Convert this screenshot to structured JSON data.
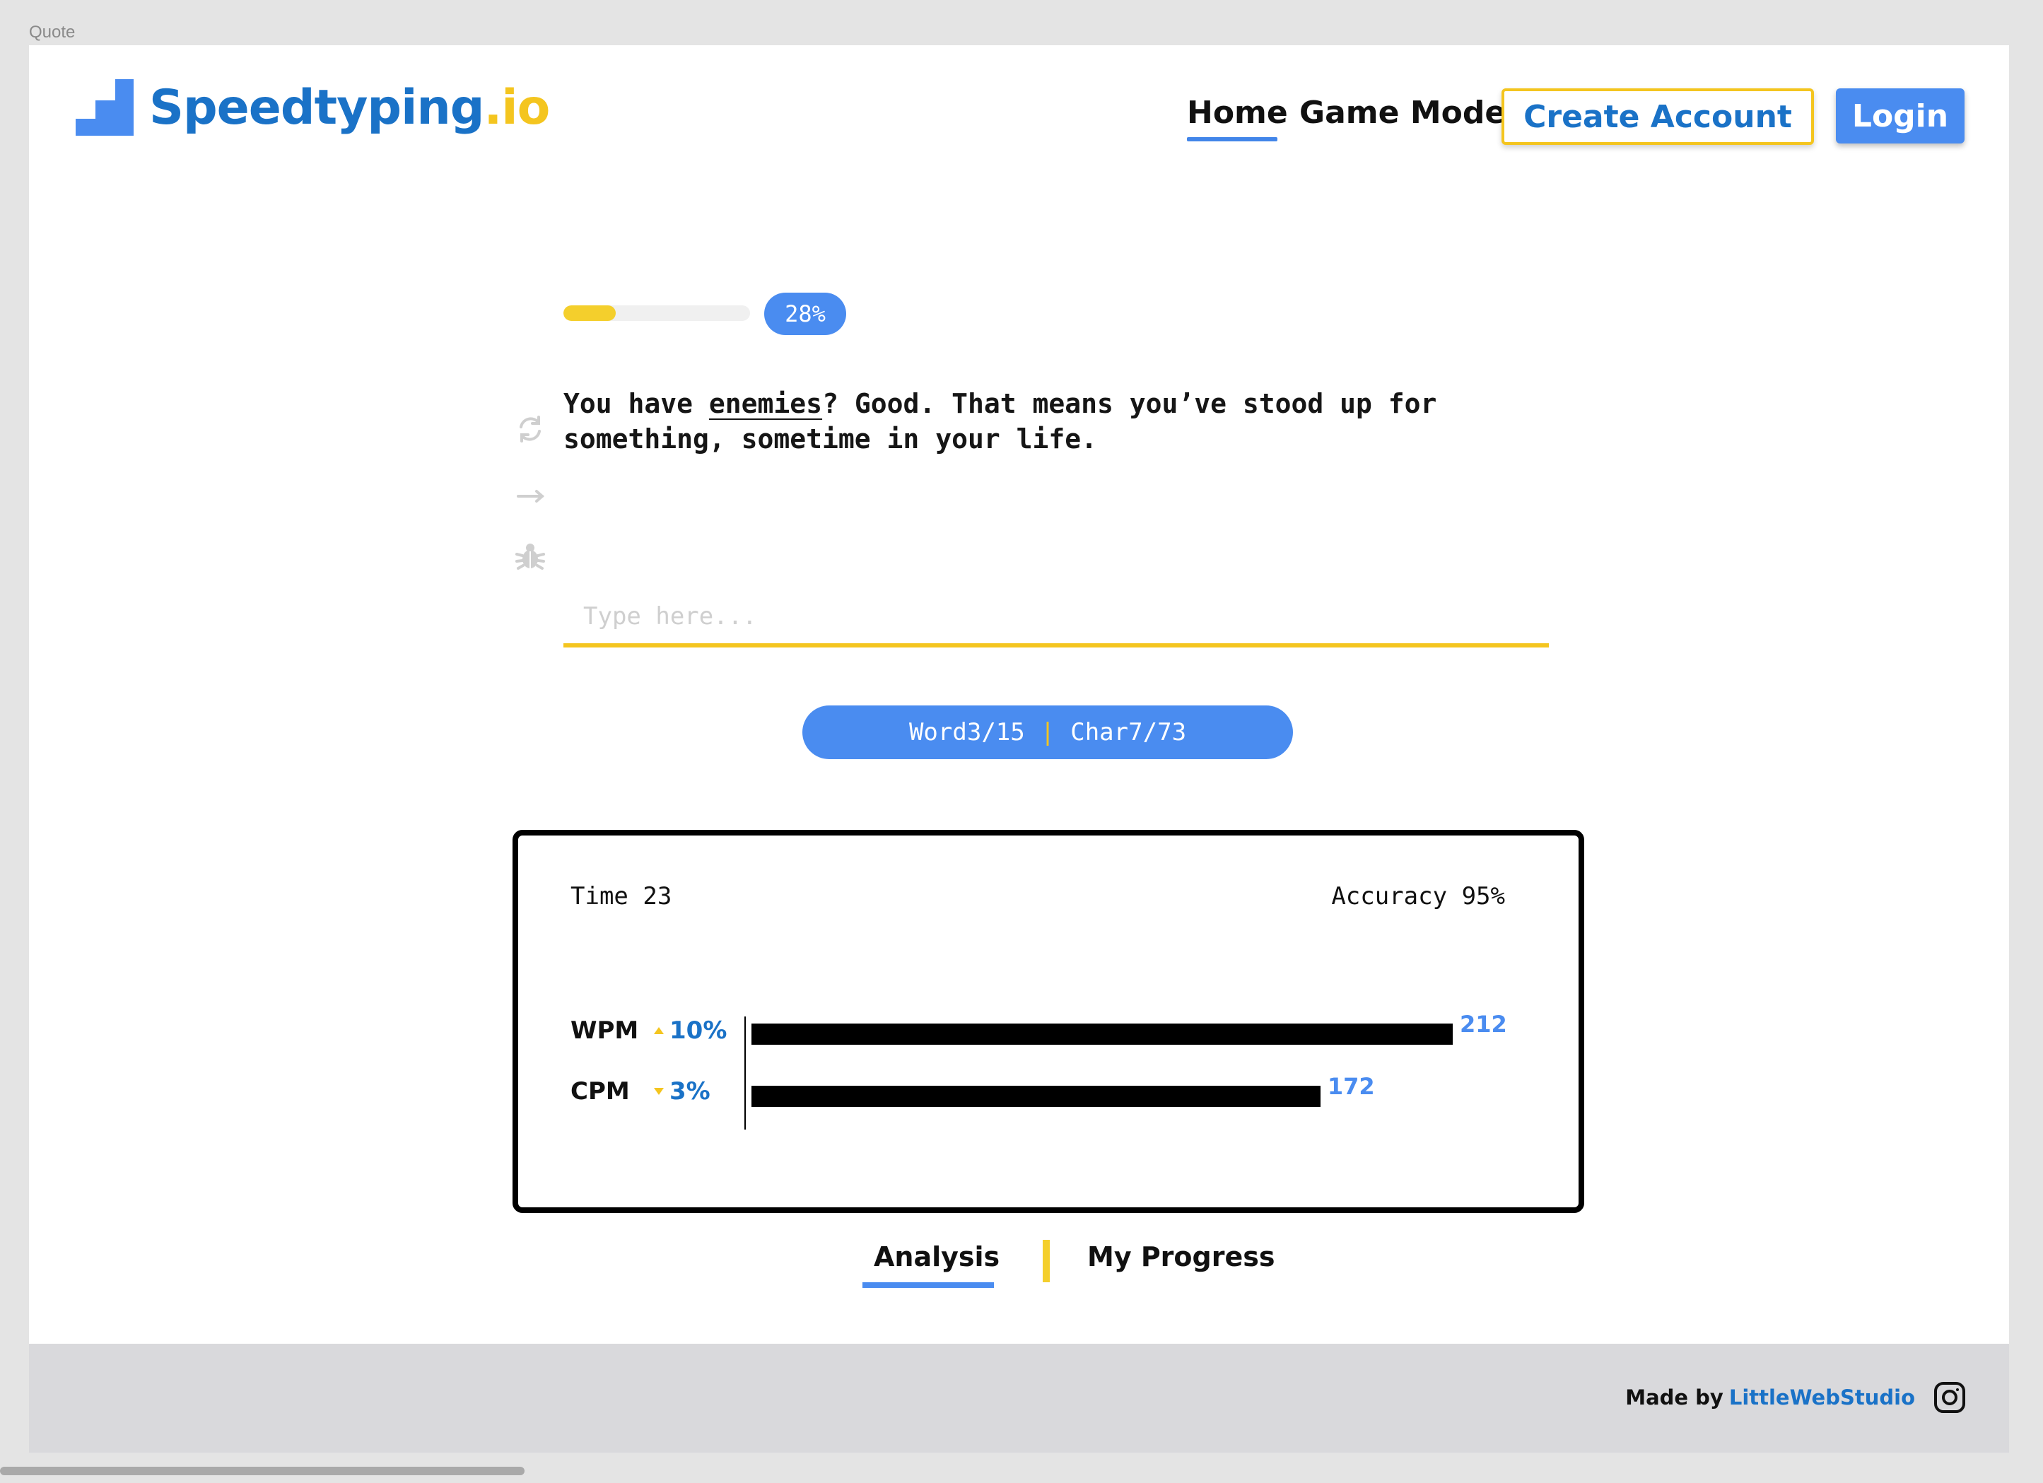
{
  "frame": {
    "label": "Quote"
  },
  "brand": {
    "name_main": "Speedtyping",
    "name_tld": ".io",
    "colors": {
      "primary": "#1a72c7",
      "accent_yellow": "#f4c51f",
      "button_blue": "#4a8cf0"
    }
  },
  "nav": {
    "home": "Home",
    "game_mode": "Game Mode",
    "create_account": "Create Account",
    "login": "Login"
  },
  "progress": {
    "percent": 0.28,
    "label": "28%"
  },
  "side_icons": [
    "refresh-icon",
    "arrow-right-icon",
    "bug-icon"
  ],
  "quote": {
    "before": "You have ",
    "current_word": "enemies",
    "after": "? Good. That means you’ve stood up for something, sometime in your life."
  },
  "input": {
    "placeholder": "Type here...",
    "value": ""
  },
  "counter": {
    "word_label": "Word",
    "word_current": "3",
    "word_total": "15",
    "char_label": "Char",
    "char_current": "7",
    "char_total": "73",
    "slash": "/",
    "separator": "|"
  },
  "stats": {
    "time_label": "Time",
    "time_value": "23",
    "accuracy_label": "Accuracy",
    "accuracy_value": "95%",
    "rows": [
      {
        "label": "WPM",
        "delta": "10%",
        "direction": "up",
        "value": "212",
        "number": 212
      },
      {
        "label": "CPM",
        "delta": "3%",
        "direction": "down",
        "value": "172",
        "number": 172
      }
    ]
  },
  "tabs": {
    "analysis": "Analysis",
    "my_progress": "My Progress",
    "active": "analysis"
  },
  "footer": {
    "made_by": "Made by",
    "studio": "LittleWebStudio",
    "social_icon": "instagram-icon"
  }
}
